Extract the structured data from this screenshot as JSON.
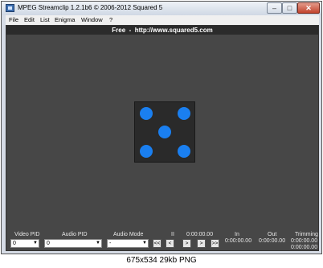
{
  "window": {
    "title": "MPEG Streamclip 1.2.1b6  ©  2006-2012 Squared 5",
    "buttons": {
      "minimize": "–",
      "maximize": "□",
      "close": "✕"
    }
  },
  "menu": [
    "File",
    "Edit",
    "List",
    "Enigma",
    "Window",
    "?"
  ],
  "top_bar_text": "Free  -  http://www.squared5.com",
  "controls": {
    "video_pid": {
      "label": "Video PID",
      "value": "0"
    },
    "audio_pid": {
      "label": "Audio PID",
      "value": "0"
    },
    "audio_mode": {
      "label": "Audio Mode",
      "value": "-"
    },
    "pause_glyph": "II",
    "current_time": "0:00:00.00",
    "transport": [
      "<<",
      "<",
      ">",
      ">",
      ">>"
    ],
    "in": {
      "label": "In",
      "value": "0:00:00.00"
    },
    "out": {
      "label": "Out",
      "value": "0:00:00.00"
    },
    "trimming": {
      "label": "Trimming",
      "value1": "0:00:00.00",
      "value2": "0:00:00.00"
    }
  },
  "caption": "675x534  29kb  PNG",
  "colors": {
    "pip": "#1a7ff0",
    "client_bg": "#474747"
  }
}
